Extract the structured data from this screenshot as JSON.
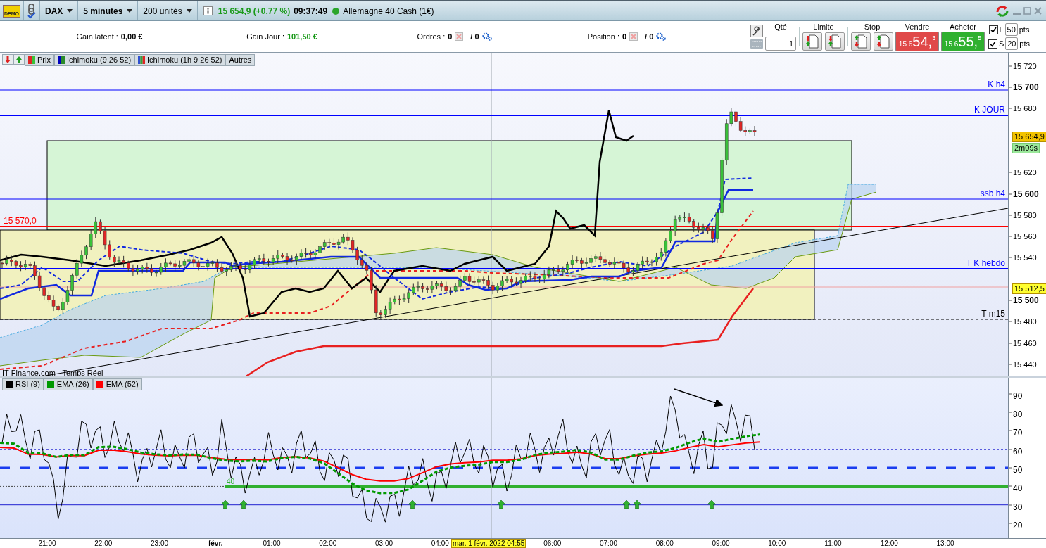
{
  "title_bar": {
    "demo_badge": "DEMO",
    "instrument": "DAX",
    "timeframe": "5 minutes",
    "units": "200 unités",
    "quote": "15 654,9 (+0,77 %)",
    "time": "09:37:49",
    "market_open": true,
    "market": "Allemagne 40 Cash (1€)"
  },
  "account": {
    "gain_latent_label": "Gain latent :",
    "gain_latent": "0,00 €",
    "gain_jour_label": "Gain Jour :",
    "gain_jour": "101,50 €",
    "orders_label": "Ordres :",
    "orders_count": "0",
    "orders_total": "/ 0",
    "position_label": "Position :",
    "position_count": "0",
    "position_total": "/ 0"
  },
  "order_ticket": {
    "qty_label": "Qté",
    "qty": "1",
    "limit_label": "Limite",
    "stop_label": "Stop",
    "sell": {
      "label": "Vendre",
      "prefix": "15 6",
      "big": "54,",
      "small": "3"
    },
    "buy": {
      "label": "Acheter",
      "prefix": "15 6",
      "big": "55,",
      "small": "5"
    },
    "distances": [
      {
        "letter": "L",
        "checked": true,
        "value": "50",
        "unit": "pts"
      },
      {
        "letter": "S",
        "checked": true,
        "value": "20",
        "unit": "pts"
      }
    ]
  },
  "price_chart": {
    "legend": [
      {
        "label": "Prix",
        "kind": "price"
      },
      {
        "label": "Ichimoku (9 26 52)",
        "kind": "ichimoku"
      },
      {
        "label": "Ichimoku (1h 9 26 52)",
        "kind": "ichimoku_multi"
      },
      {
        "label": "Autres",
        "kind": "other"
      }
    ],
    "levels": [
      {
        "label": "K h4",
        "color": "#0000ff"
      },
      {
        "label": "K JOUR",
        "color": "#0000ff"
      },
      {
        "label": "ssb h4",
        "color": "#0000ff"
      },
      {
        "label": "15 570,0",
        "color": "#ff0000"
      },
      {
        "label": "T K hebdo",
        "color": "#0000ff"
      },
      {
        "label": "T m15",
        "color": "#000000"
      }
    ],
    "source": "IT-Finance.com - Temps Réel",
    "axis_ticks": [
      {
        "label": "15 720",
        "major": false
      },
      {
        "label": "15 700",
        "major": true
      },
      {
        "label": "15 680",
        "major": false
      },
      {
        "label": "15 620",
        "major": false
      },
      {
        "label": "15 600",
        "major": true
      },
      {
        "label": "15 580",
        "major": false
      },
      {
        "label": "15 560",
        "major": false
      },
      {
        "label": "15 540",
        "major": false
      },
      {
        "label": "15 500",
        "major": true
      },
      {
        "label": "15 480",
        "major": false
      },
      {
        "label": "15 460",
        "major": false
      },
      {
        "label": "15 440",
        "major": false
      }
    ],
    "badges": [
      {
        "text": "15 654,9",
        "kind": "last"
      },
      {
        "text": "2m09s",
        "kind": "timer"
      },
      {
        "text": "15 512,5",
        "kind": "alert"
      }
    ]
  },
  "rsi_panel": {
    "legend": [
      {
        "label": "RSI (9)",
        "color": "#000000"
      },
      {
        "label": "EMA (26)",
        "color": "#009900"
      },
      {
        "label": "EMA (52)",
        "color": "#ff0000"
      }
    ],
    "level_label": "40",
    "axis_ticks": [
      "90",
      "80",
      "70",
      "60",
      "50",
      "40",
      "30",
      "20"
    ]
  },
  "time_axis": {
    "labels": [
      {
        "label": "21:00",
        "bold": false
      },
      {
        "label": "22:00",
        "bold": false
      },
      {
        "label": "23:00",
        "bold": false
      },
      {
        "label": "févr.",
        "bold": true
      },
      {
        "label": "01:00",
        "bold": false
      },
      {
        "label": "02:00",
        "bold": false
      },
      {
        "label": "03:00",
        "bold": false
      },
      {
        "label": "04:00",
        "bold": false
      },
      {
        "label": "06:00",
        "bold": false
      },
      {
        "label": "07:00",
        "bold": false
      },
      {
        "label": "08:00",
        "bold": false
      },
      {
        "label": "09:00",
        "bold": false
      },
      {
        "label": "10:00",
        "bold": false
      },
      {
        "label": "11:00",
        "bold": false
      },
      {
        "label": "12:00",
        "bold": false
      },
      {
        "label": "13:00",
        "bold": false
      }
    ],
    "cursor_label": "mar. 1 févr. 2022 04:55"
  }
}
